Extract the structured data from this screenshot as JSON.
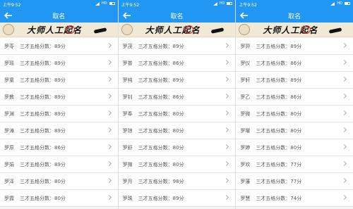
{
  "status_time": "上午9:52",
  "status_net": "HD",
  "title": "取名",
  "banner_text": "大师人工起名",
  "panels": [
    {
      "rows": [
        {
          "name": "罗苓",
          "score": "三才五格分数：89分"
        },
        {
          "name": "罗瑶",
          "score": "三才五格分数：89分"
        },
        {
          "name": "罗童",
          "score": "三才五格分数：89分"
        },
        {
          "name": "罗教",
          "score": "三才五格分数：89分"
        },
        {
          "name": "罗渊",
          "score": "三才五格分数：89分"
        },
        {
          "name": "罗涛",
          "score": "三才五格分数：89分"
        },
        {
          "name": "罗原",
          "score": "三才五格分数：86分"
        },
        {
          "name": "罗娟",
          "score": "三才五格分数：89分"
        },
        {
          "name": "罗泽",
          "score": "三才五格分数：80分"
        },
        {
          "name": "罗霞",
          "score": "三才五格分数：80分"
        }
      ]
    },
    {
      "rows": [
        {
          "name": "罗茂",
          "score": "三才五格分数：89分"
        },
        {
          "name": "罗普",
          "score": "三才五格分数：86分"
        },
        {
          "name": "罗纯",
          "score": "三才五格分数：89分"
        },
        {
          "name": "罗钊",
          "score": "三才五格分数：86分"
        },
        {
          "name": "罗奉",
          "score": "三才五格分数：80分"
        },
        {
          "name": "罗琼",
          "score": "三才五格分数：80分"
        },
        {
          "name": "罗舒",
          "score": "三才五格分数：80分"
        },
        {
          "name": "罗微",
          "score": "三才五格分数：80分"
        },
        {
          "name": "罗月",
          "score": "三才五格分数：98分"
        },
        {
          "name": "罗珠",
          "score": "三才五格分数：89分"
        }
      ]
    },
    {
      "rows": [
        {
          "name": "罗羿",
          "score": "三才五格分数：89分"
        },
        {
          "name": "罗仪",
          "score": "三才五格分数：86分"
        },
        {
          "name": "罗轩",
          "score": "三才五格分数：89分"
        },
        {
          "name": "罗乙",
          "score": "三才五格分数：86分"
        },
        {
          "name": "罗微",
          "score": "三才五格分数：80分"
        },
        {
          "name": "罗曜",
          "score": "三才五格分数：80分"
        },
        {
          "name": "罗婷",
          "score": "三才五格分数：80分"
        },
        {
          "name": "罗欢",
          "score": "三才五格分数：77分"
        },
        {
          "name": "罗藩",
          "score": "三才五格分数：77分"
        },
        {
          "name": "罗慧",
          "score": "三才五格分数：74分"
        }
      ]
    }
  ]
}
